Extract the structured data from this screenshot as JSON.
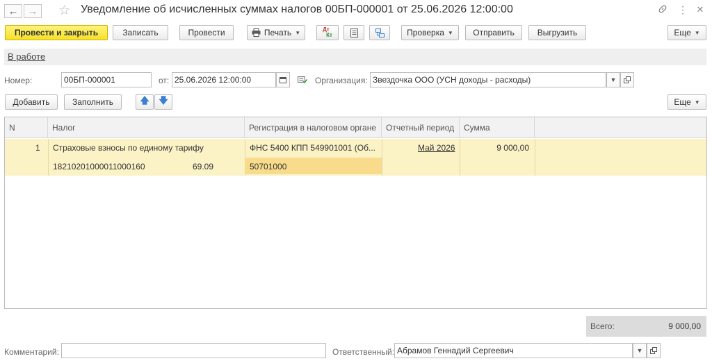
{
  "window": {
    "title": "Уведомление об исчисленных суммах налогов 00БП-000001 от 25.06.2026 12:00:00"
  },
  "toolbar": {
    "post_close": "Провести и закрыть",
    "save": "Записать",
    "post": "Провести",
    "print": "Печать",
    "check": "Проверка",
    "send": "Отправить",
    "export": "Выгрузить",
    "more": "Еще",
    "dtkt_icon_top": "Дт",
    "dtkt_icon_bottom": "Кт"
  },
  "status": {
    "label": "В работе"
  },
  "form": {
    "number_label": "Номер:",
    "number_value": "00БП-000001",
    "date_label": "от:",
    "date_value": "25.06.2026 12:00:00",
    "org_label": "Организация:",
    "org_value": "Звездочка ООО (УСН доходы - расходы)"
  },
  "table_toolbar": {
    "add": "Добавить",
    "fill": "Заполнить",
    "more": "Еще"
  },
  "table": {
    "headers": {
      "n": "N",
      "tax": "Налог",
      "registration": "Регистрация в налоговом органе",
      "period": "Отчетный период",
      "sum": "Сумма"
    },
    "rows": [
      {
        "n": "1",
        "tax": "Страховые взносы по единому тарифу",
        "kbk": "18210201000011000160",
        "account": "69.09",
        "registration": "ФНС 5400 КПП 549901001 (Об...",
        "oktmo": "50701000",
        "period": "Май 2026",
        "sum": "9 000,00"
      }
    ]
  },
  "totals": {
    "label": "Всего:",
    "value": "9 000,00"
  },
  "footer": {
    "comment_label": "Комментарий:",
    "comment_value": "",
    "responsible_label": "Ответственный:",
    "responsible_value": "Абрамов Геннадий Сергеевич"
  },
  "icons": {
    "back": "arrow-left",
    "forward": "arrow-right",
    "favorite": "star",
    "link": "link",
    "menu": "vertical-dots",
    "close": "close",
    "printer": "printer",
    "dtkt": "debit-credit",
    "report": "report",
    "structure": "structure",
    "calendar": "calendar",
    "doc_status": "doc-check",
    "up": "arrow-up",
    "down": "arrow-down"
  },
  "colors": {
    "primary_button": "#f5e12a",
    "selected_row": "#fbf2c6",
    "active_cell": "#f8dc8c",
    "arrow_blue": "#3b7fd0"
  }
}
